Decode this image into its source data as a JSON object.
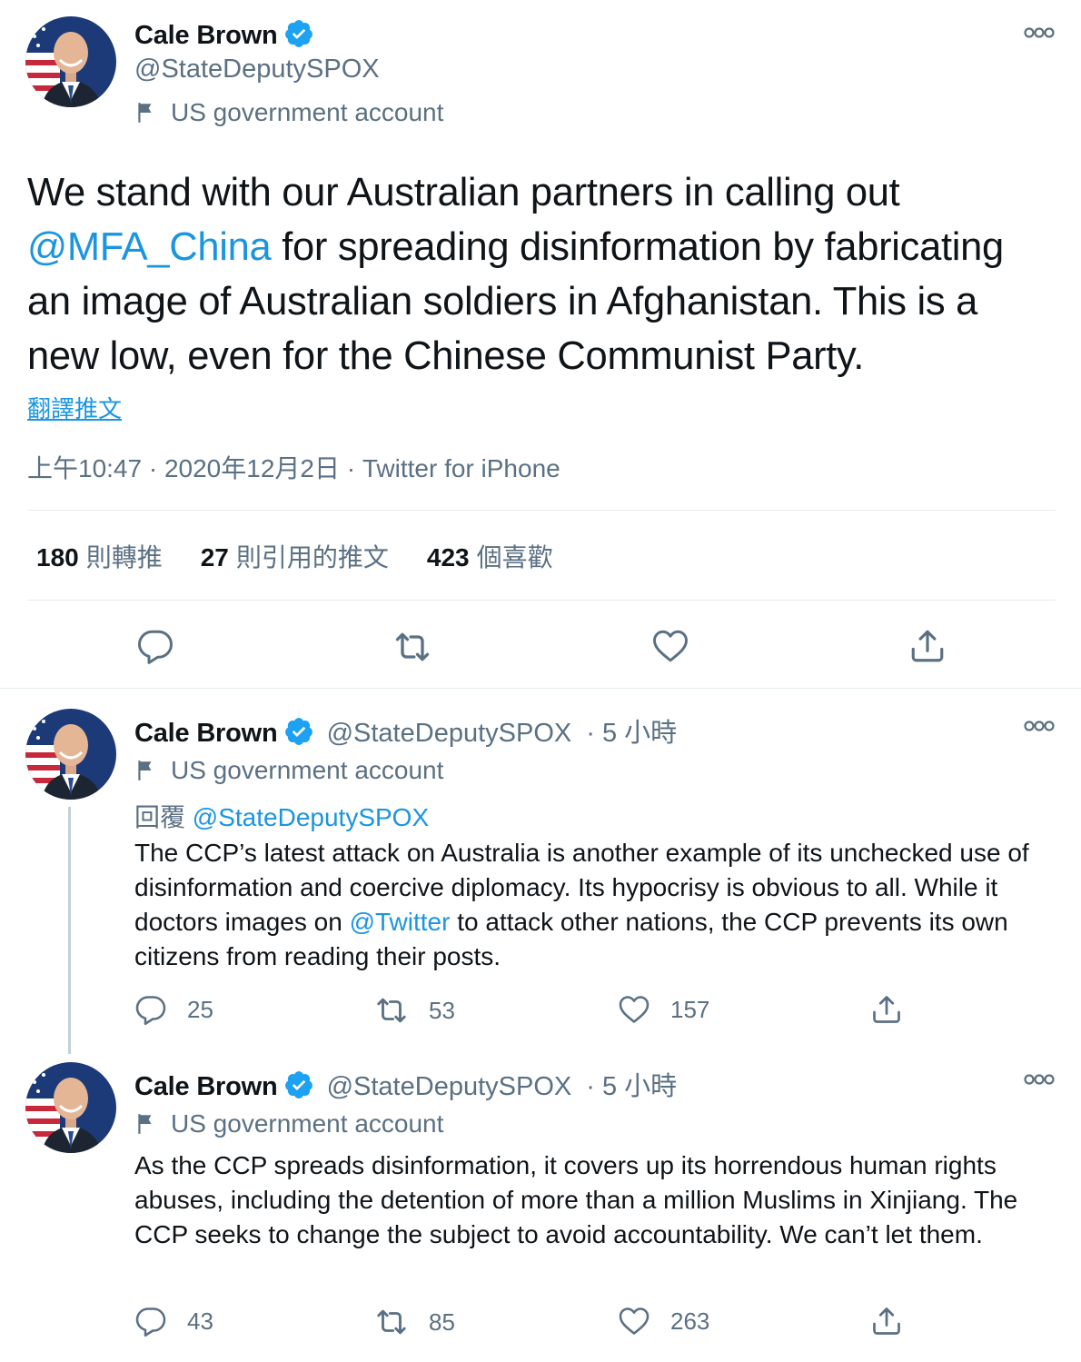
{
  "main_tweet": {
    "display_name": "Cale Brown",
    "handle": "@StateDeputySPOX",
    "gov_label": "US government account",
    "text_part1": "We stand with our Australian partners in calling out ",
    "mention": "@MFA_China",
    "text_part2": " for spreading disinformation by fabricating an image of Australian soldiers in Afghanistan. This is a new low, even for the Chinese Communist Party.",
    "translate_label": "翻譯推文",
    "meta": "上午10:47 · 2020年12月2日 · Twitter for iPhone",
    "stats": {
      "retweets_count": "180",
      "retweets_label": "則轉推",
      "quotes_count": "27",
      "quotes_label": "則引用的推文",
      "likes_count": "423",
      "likes_label": "個喜歡"
    }
  },
  "replies": [
    {
      "display_name": "Cale Brown",
      "handle": "@StateDeputySPOX",
      "time": "· 5 小時",
      "gov_label": "US government account",
      "reply_prefix": "回覆",
      "reply_to": "@StateDeputySPOX",
      "text_part1": "The CCP’s latest attack on Australia is another example of its unchecked use of disinformation and coercive diplomacy. Its hypocrisy is obvious to all. While it doctors images on ",
      "mention": "@Twitter",
      "text_part2": " to attack other nations, the CCP prevents its own citizens from reading their posts.",
      "reply_count": "25",
      "retweet_count": "53",
      "like_count": "157"
    },
    {
      "display_name": "Cale Brown",
      "handle": "@StateDeputySPOX",
      "time": "· 5 小時",
      "gov_label": "US government account",
      "text": "As the CCP spreads disinformation, it covers up its horrendous human rights abuses, including the detention of more than a million Muslims in Xinjiang. The CCP seeks to change the subject to avoid accountability. We can’t let them.",
      "reply_count": "43",
      "retweet_count": "85",
      "like_count": "263"
    }
  ],
  "colors": {
    "accent": "#1b95e0",
    "text": "#0f1419",
    "muted": "#5b7083",
    "divider": "#e6ecf0"
  }
}
